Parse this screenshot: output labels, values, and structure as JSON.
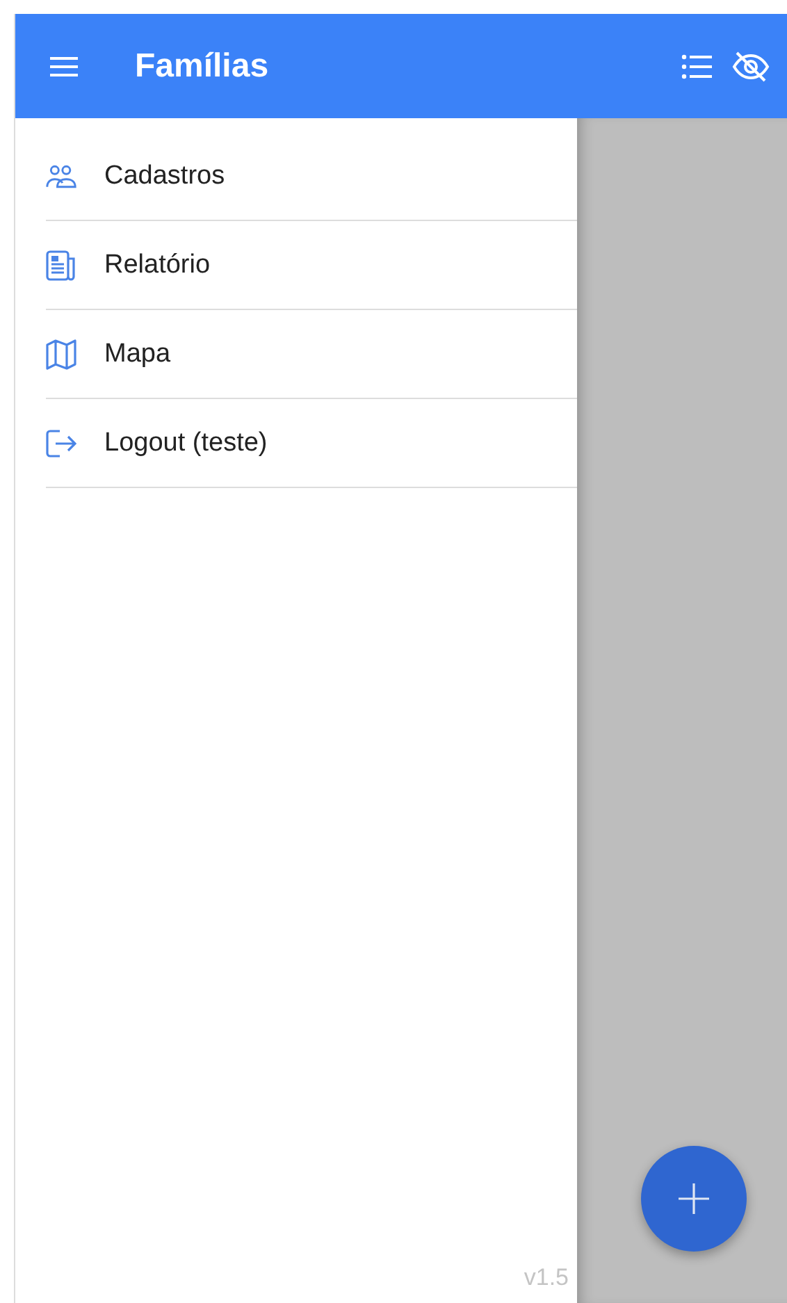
{
  "app_bar": {
    "title": "Famílias"
  },
  "drawer": {
    "items": [
      {
        "label": "Cadastros"
      },
      {
        "label": "Relatório"
      },
      {
        "label": "Mapa"
      },
      {
        "label": "Logout (teste)"
      }
    ],
    "version": "v1.5"
  }
}
